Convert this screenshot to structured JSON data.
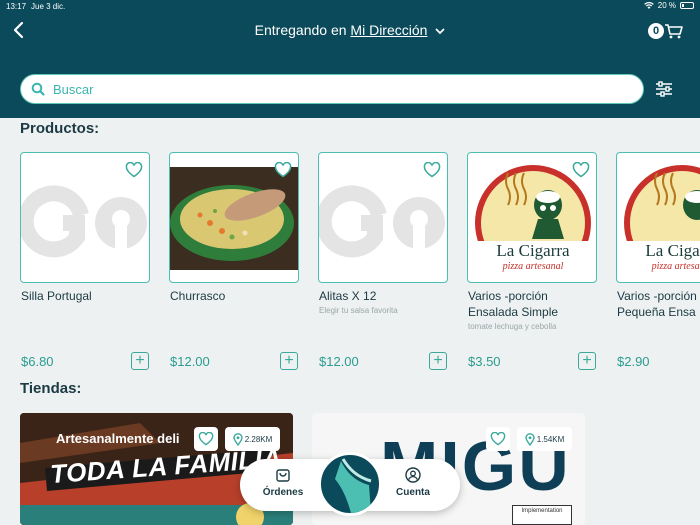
{
  "status_bar": {
    "time": "13:17",
    "date": "Jue 3 dic.",
    "battery": "20 %"
  },
  "header": {
    "deliver_prefix": "Entregando en",
    "address": "Mi Dirección",
    "cart_count": "0"
  },
  "search": {
    "placeholder": "Buscar",
    "value": ""
  },
  "sections": {
    "products": "Productos:",
    "stores": "Tiendas:"
  },
  "products": [
    {
      "name": "Silla Portugal",
      "desc": "",
      "price": "$6.80",
      "image": "go-placeholder"
    },
    {
      "name": "Churrasco",
      "desc": "",
      "price": "$12.00",
      "image": "soup-photo"
    },
    {
      "name": "Alitas X 12",
      "desc": "Elegir tu salsa favorita",
      "price": "$12.00",
      "image": "go-placeholder"
    },
    {
      "name": "Varios -porción Ensalada Simple",
      "desc": "tomate lechuga y cebolla",
      "price": "$3.50",
      "image": "la-cigarra-logo"
    },
    {
      "name": "Varios -porción Pequeña Ensa",
      "desc": "",
      "price": "$2.90",
      "image": "la-cigarra-logo"
    }
  ],
  "logo_text": {
    "brand": "La Cigarra",
    "sub": "pizza artesanal"
  },
  "stores": [
    {
      "banner_line1": "Artesanalmente deli",
      "banner_line2": "TODA LA FAMILIA",
      "distance": "2.28KM"
    },
    {
      "banner": "MIGU",
      "distance": "1.54KM",
      "small_sign": "Implementation"
    }
  ],
  "bottom_nav": {
    "orders": "Órdenes",
    "account": "Cuenta"
  },
  "colors": {
    "header": "#0b4a5a",
    "accent": "#4cbfb2",
    "price": "#2a9c91",
    "background": "#eef1f1"
  }
}
